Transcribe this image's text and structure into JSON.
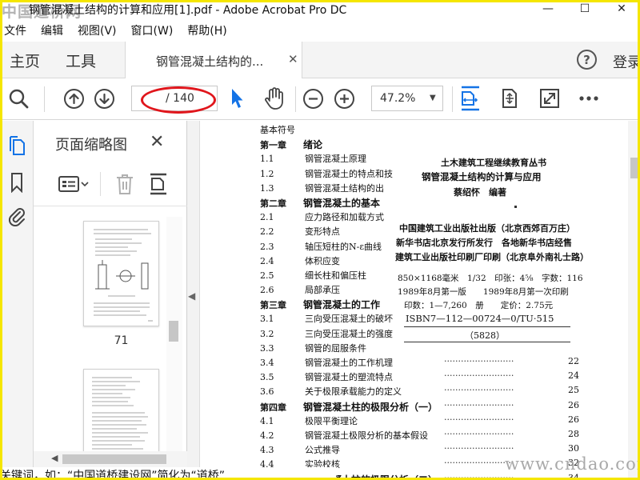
{
  "window": {
    "watermark_top": "中国道桥网",
    "title": "钢管混凝土结构的计算和应用[1].pdf - Adobe Acrobat Pro DC",
    "minimize": "—",
    "maximize": "☐",
    "close": "✕"
  },
  "menu": [
    "文件",
    "编辑",
    "视图(V)",
    "窗口(W)",
    "帮助(H)"
  ],
  "tabs": {
    "home": "主页",
    "tools": "工具",
    "document": "钢管混凝土结构的...",
    "doc_close": "✕",
    "help": "?",
    "signin": "登录"
  },
  "toolbar": {
    "page_current": "",
    "page_total": "/ 140",
    "zoom": "47.2%"
  },
  "thumbnails": {
    "title": "页面缩略图",
    "close": "✕",
    "items": [
      {
        "label": "71"
      },
      {
        "label": ""
      }
    ]
  },
  "document": {
    "toc": [
      {
        "num": "基本符号",
        "text": "",
        "page": "",
        "chapter": false
      },
      {
        "num": "第一章",
        "text": "绪论",
        "page": "",
        "chapter": true
      },
      {
        "num": "1.1",
        "text": "钢管混凝土原理",
        "page": "",
        "chapter": false
      },
      {
        "num": "1.2",
        "text": "钢管混凝土的特点和技",
        "page": "",
        "chapter": false
      },
      {
        "num": "1.3",
        "text": "钢管混凝土结构的出",
        "page": "",
        "chapter": false
      },
      {
        "num": "第二章",
        "text": "钢管混凝土的基本",
        "page": "",
        "chapter": true
      },
      {
        "num": "2.1",
        "text": "应力路径和加载方式",
        "page": "",
        "chapter": false
      },
      {
        "num": "2.2",
        "text": "变形特点",
        "page": "",
        "chapter": false
      },
      {
        "num": "2.3",
        "text": "轴压短柱的N-ε曲线",
        "page": "",
        "chapter": false
      },
      {
        "num": "2.4",
        "text": "体积应变",
        "page": "",
        "chapter": false
      },
      {
        "num": "2.5",
        "text": "细长柱和偏压柱",
        "page": "",
        "chapter": false
      },
      {
        "num": "2.6",
        "text": "局部承压",
        "page": "",
        "chapter": false
      },
      {
        "num": "第三章",
        "text": "钢管混凝土的工作",
        "page": "",
        "chapter": true
      },
      {
        "num": "3.1",
        "text": "三向受压混凝土的破坏",
        "page": "",
        "chapter": false
      },
      {
        "num": "3.2",
        "text": "三向受压混凝土的强度",
        "page": "",
        "chapter": false
      },
      {
        "num": "3.3",
        "text": "钢管的屈服条件",
        "page": "21",
        "chapter": false
      },
      {
        "num": "3.4",
        "text": "钢管混凝土的工作机理",
        "page": "22",
        "chapter": false
      },
      {
        "num": "3.5",
        "text": "钢管混凝土的塑流特点",
        "page": "24",
        "chapter": false
      },
      {
        "num": "3.6",
        "text": "关于极限承载能力的定义",
        "page": "25",
        "chapter": false
      },
      {
        "num": "第四章",
        "text": "钢管混凝土柱的极限分析（一）",
        "page": "26",
        "chapter": true
      },
      {
        "num": "4.1",
        "text": "极限平衡理论",
        "page": "26",
        "chapter": false
      },
      {
        "num": "4.2",
        "text": "钢管混凝土极限分析的基本假设",
        "page": "28",
        "chapter": false
      },
      {
        "num": "4.3",
        "text": "公式推导",
        "page": "30",
        "chapter": false
      },
      {
        "num": "4.4",
        "text": "实验校核",
        "page": "32",
        "chapter": false
      },
      {
        "num": "第五章",
        "text": "钢管混凝土柱的极限分析（二）",
        "page": "34",
        "chapter": true
      }
    ],
    "pub": {
      "series": "土木建筑工程继续教育丛书",
      "book_title": "钢管混凝土结构的计算与应用",
      "author": "蔡绍怀　编著",
      "publisher": "中国建筑工业出版社出版（北京西郊百万庄）",
      "distributor": "新华书店北京发行所发行　各地新华书店经售",
      "printer": "建筑工业出版社印刷厂印刷（北京阜外南礼士路）",
      "format": "850×1168毫米　1/32　印张：4⅝　字数：116",
      "dates": "1989年8月第一版　　1989年8月第一次印刷",
      "print_run": "印数：1—7,260　册　　定价：2.75元",
      "isbn": "ISBN7—112—00724—0/TU·515",
      "code": "（5828）"
    }
  },
  "footer": {
    "bottom_text": "关键词，如：“中国道桥建设网”简化为“道桥”",
    "watermark": "www.cndao.com"
  }
}
